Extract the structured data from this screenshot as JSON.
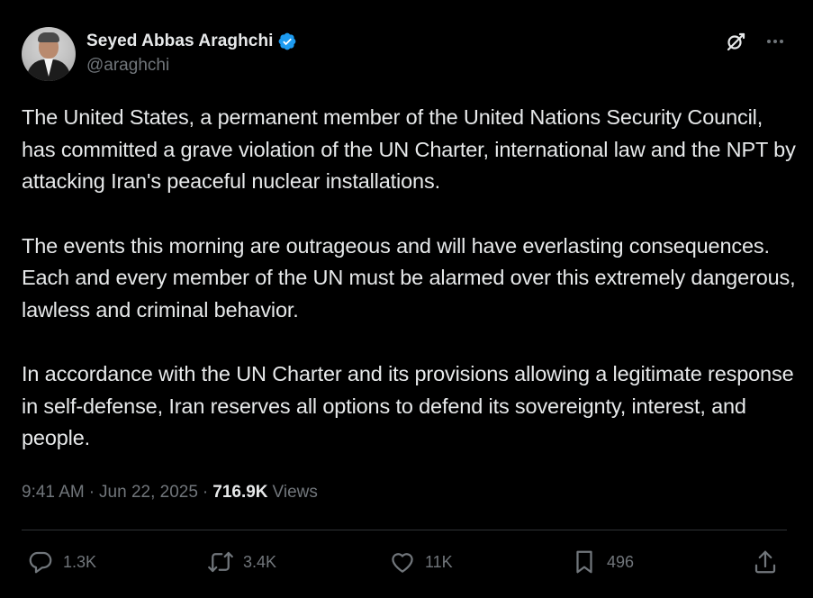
{
  "author": {
    "display_name": "Seyed Abbas Araghchi",
    "handle": "@araghchi",
    "verified": true,
    "verified_color": "#1d9bf0"
  },
  "post": {
    "paragraphs": [
      "The United States, a permanent member of the United Nations Security Council, has committed a grave violation of the UN Charter, international law and the NPT by attacking Iran's peaceful nuclear installations.",
      "The events this morning are outrageous and will have everlasting consequences. Each and every member of the UN must be alarmed over this extremely dangerous, lawless and criminal behavior.",
      "In accordance with the UN Charter and its provisions allowing a legitimate response in self-defense, Iran reserves all options to defend its sovereignty, interest, and people."
    ]
  },
  "meta": {
    "time": "9:41 AM",
    "separator": "·",
    "date": "Jun 22, 2025",
    "views_count": "716.9K",
    "views_label": "Views"
  },
  "actions": {
    "replies": "1.3K",
    "reposts": "3.4K",
    "likes": "11K",
    "bookmarks": "496"
  },
  "icons": {
    "grok": "grok-icon",
    "more": "more-icon",
    "reply": "reply-icon",
    "repost": "repost-icon",
    "like": "heart-icon",
    "bookmark": "bookmark-icon",
    "share": "share-icon"
  },
  "colors": {
    "background": "#000000",
    "text_primary": "#e7e9ea",
    "text_secondary": "#71767b",
    "divider": "#2f3336"
  }
}
